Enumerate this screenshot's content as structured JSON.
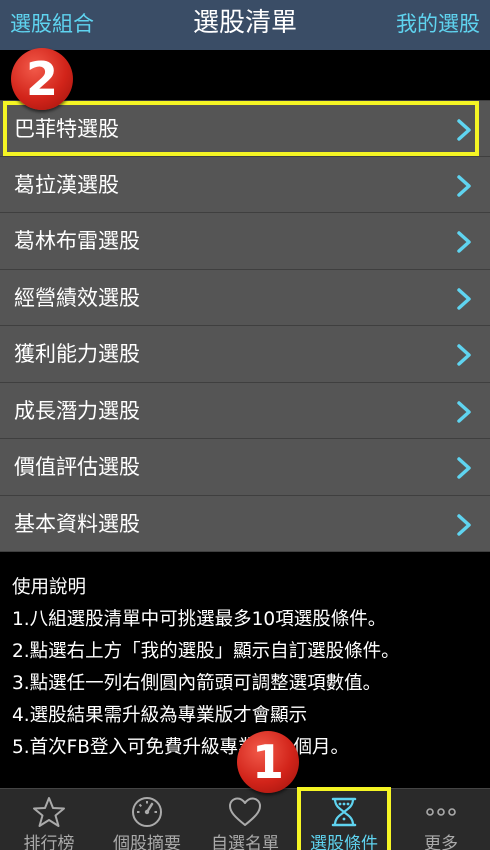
{
  "header": {
    "left_label": "選股組合",
    "title": "選股清單",
    "right_label": "我的選股"
  },
  "list": {
    "items": [
      {
        "label": "巴菲特選股"
      },
      {
        "label": "葛拉漢選股"
      },
      {
        "label": "葛林布雷選股"
      },
      {
        "label": "經營績效選股"
      },
      {
        "label": "獲利能力選股"
      },
      {
        "label": "成長潛力選股"
      },
      {
        "label": "價值評估選股"
      },
      {
        "label": "基本資料選股"
      }
    ]
  },
  "badges": {
    "step1": "1",
    "step2": "2"
  },
  "help": {
    "title": "使用說明",
    "lines": [
      "1.八組選股清單中可挑選最多10項選股條件。",
      "2.點選右上方「我的選股」顯示自訂選股條件。",
      "3.點選任一列右側圓內箭頭可調整選項數值。",
      "4.選股結果需升級為專業版才會顯示",
      "5.首次FB登入可免費升級專業版一個月。"
    ]
  },
  "tabbar": {
    "tabs": [
      {
        "label": "排行榜",
        "icon": "star-icon"
      },
      {
        "label": "個股摘要",
        "icon": "gauge-icon"
      },
      {
        "label": "自選名單",
        "icon": "heart-icon"
      },
      {
        "label": "選股條件",
        "icon": "hourglass-icon"
      },
      {
        "label": "更多",
        "icon": "more-dots-icon"
      }
    ],
    "active_index": 3
  },
  "colors": {
    "header_bg": "#3a4d66",
    "accent": "#5fd4f0",
    "highlight": "#f5f524",
    "badge": "#d2241a",
    "row_bg": "#555555"
  }
}
